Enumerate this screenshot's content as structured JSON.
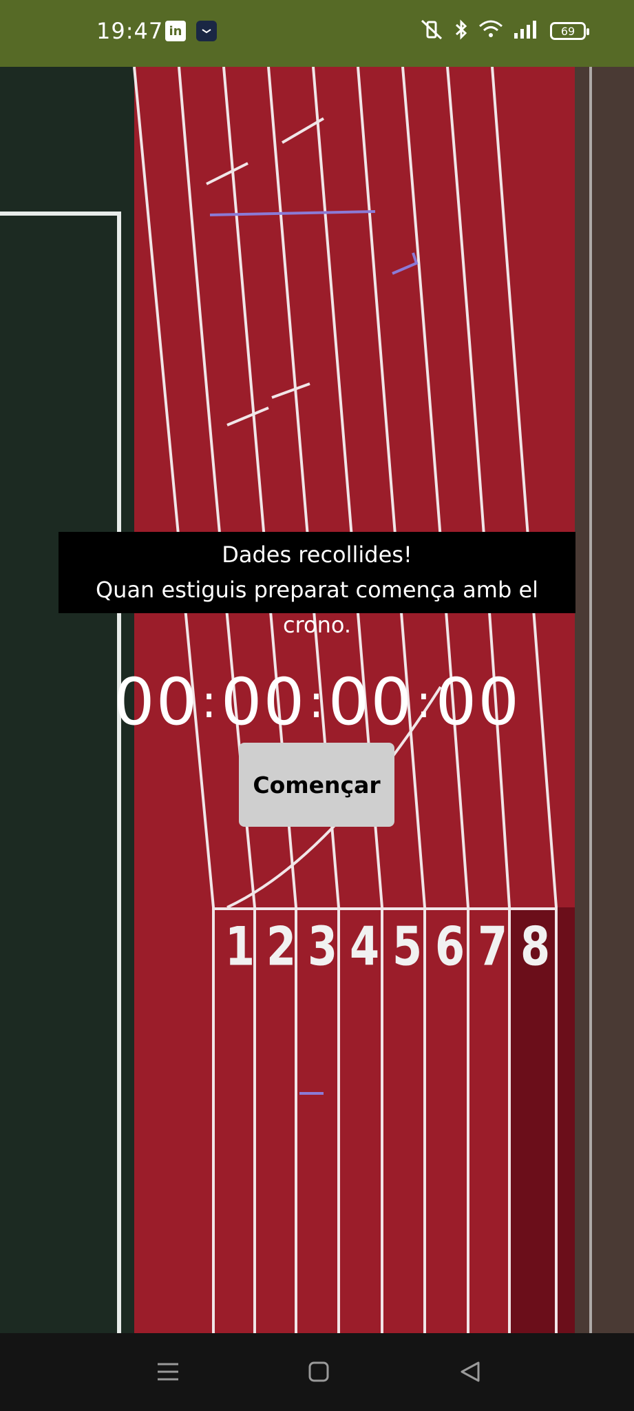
{
  "status_bar": {
    "time": "19:47",
    "battery": "69",
    "icons": [
      "linkedin-icon",
      "clock-app-icon",
      "vibrate-off-icon",
      "bluetooth-icon",
      "wifi-icon",
      "signal-icon",
      "battery-icon"
    ]
  },
  "message": {
    "line1": "Dades recollides!",
    "line2": "Quan estiguis preparat comença amb el crono."
  },
  "timer": {
    "h": "00",
    "m": "00",
    "s": "00",
    "cs": "00",
    "sep": ":"
  },
  "start_button": {
    "label": "Començar"
  },
  "background": {
    "lane_numbers": [
      "1",
      "2",
      "3",
      "4",
      "5",
      "6",
      "7",
      "8"
    ],
    "colors": {
      "track": "#9b1d2a",
      "field": "#1c2a22",
      "status_bar": "#566a26"
    }
  },
  "nav": {
    "icons": [
      "menu-icon",
      "home-icon",
      "back-icon"
    ]
  }
}
